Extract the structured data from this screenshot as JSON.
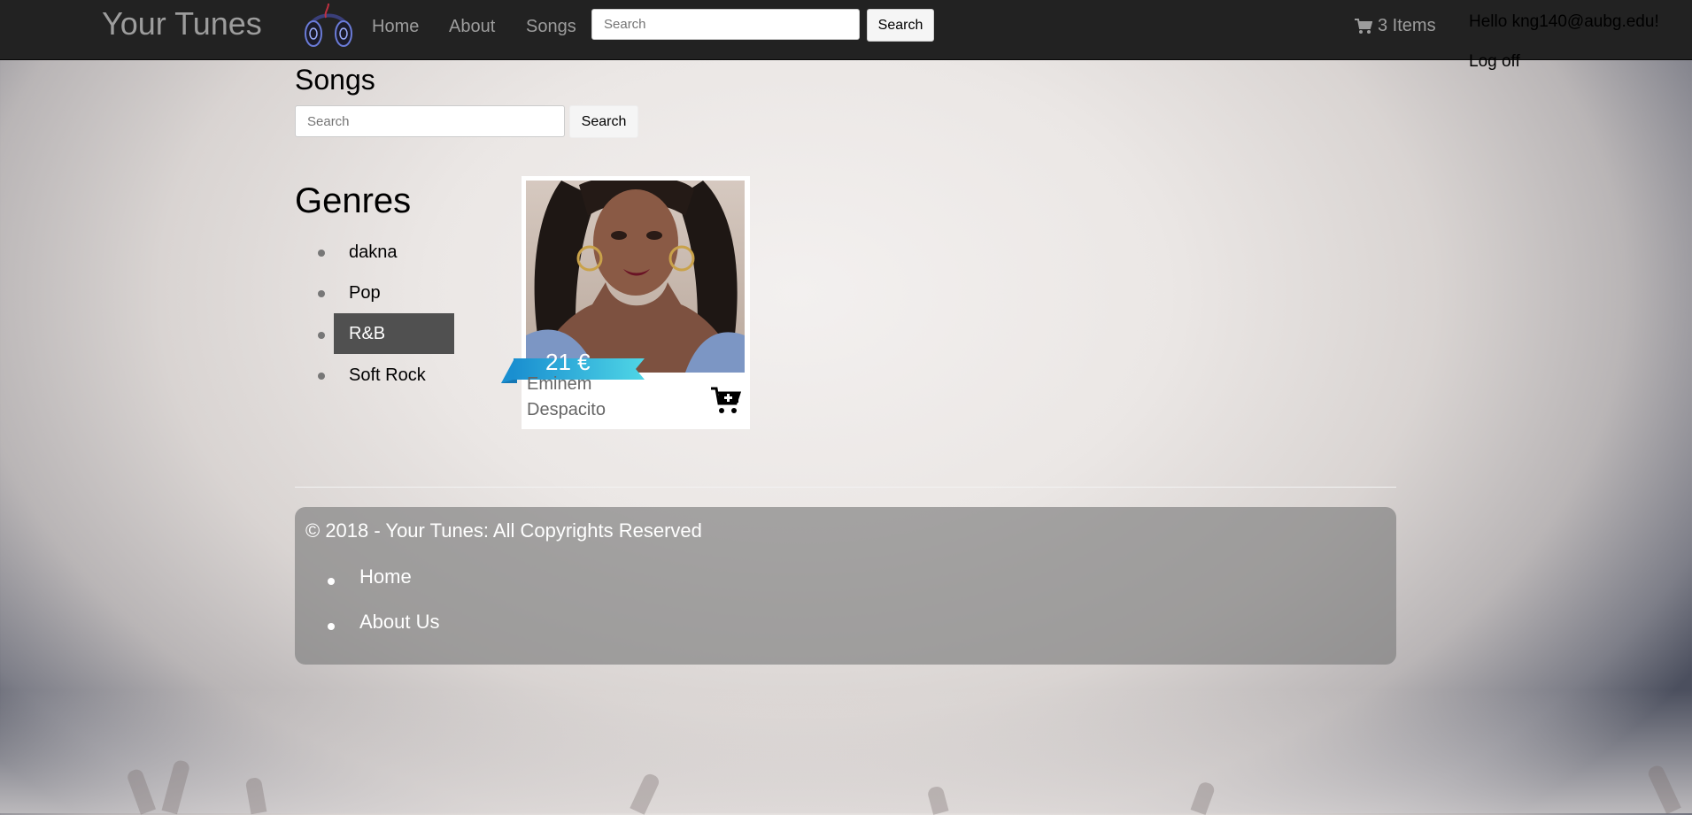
{
  "navbar": {
    "brand": "Your Tunes",
    "links": [
      "Home",
      "About",
      "Songs"
    ],
    "search_placeholder": "Search",
    "search_button": "Search",
    "cart_label": "3 Items",
    "greeting": "Hello kng140@aubg.edu!",
    "logoff": "Log off"
  },
  "page": {
    "title": "Songs",
    "search_placeholder": "Search",
    "search_button": "Search"
  },
  "genres": {
    "title": "Genres",
    "items": [
      "dakna",
      "Pop",
      "R&B",
      "Soft Rock"
    ],
    "active": "R&B"
  },
  "album": {
    "price": "21 €",
    "artist": "Eminem",
    "song": "Despacito"
  },
  "footer": {
    "copyright": "© 2018 - Your Tunes: All Copyrights Reserved",
    "links": [
      "Home",
      "About Us"
    ]
  },
  "colors": {
    "navbar_bg": "#222222",
    "nav_text": "#9d9d9d",
    "genre_active_bg": "#505050",
    "ribbon_light": "#4fd6e6",
    "ribbon_dark": "#1a8fd0"
  }
}
